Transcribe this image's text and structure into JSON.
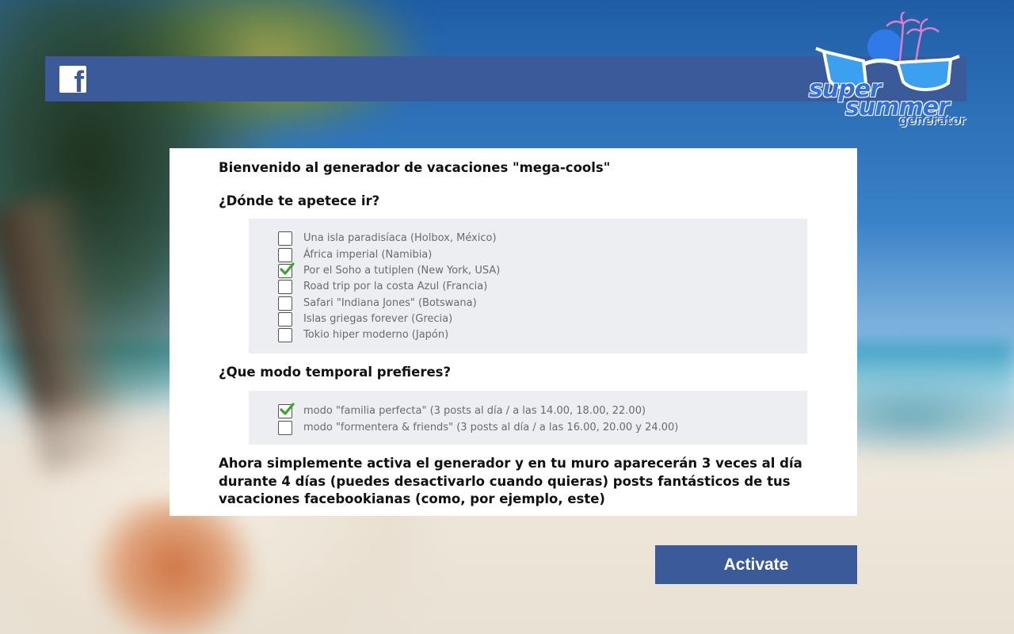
{
  "header": {
    "fb_icon": "facebook-icon",
    "fb_glyph": "f",
    "brand_line1": "super",
    "brand_line2": "summer",
    "brand_line3": "generator"
  },
  "card": {
    "welcome": "Bienvenido al generador de vacaciones \"mega-cools\"",
    "question_destination": "¿Dónde te apetece ir?",
    "destinations": [
      {
        "label": "Una isla paradisíaca (Holbox, México)",
        "checked": false
      },
      {
        "label": "África imperial (Namibia)",
        "checked": false
      },
      {
        "label": "Por el Soho a tutiplen (New York, USA)",
        "checked": true
      },
      {
        "label": "Road trip por la costa Azul (Francia)",
        "checked": false
      },
      {
        "label": "Safari \"Indiana Jones\" (Botswana)",
        "checked": false
      },
      {
        "label": "Islas griegas forever (Grecia)",
        "checked": false
      },
      {
        "label": "Tokio hiper moderno (Japón)",
        "checked": false
      }
    ],
    "question_mode": "¿Que modo temporal prefieres?",
    "modes": [
      {
        "label": "modo \"familia perfecta\" (3 posts al día / a las 14.00, 18.00, 22.00)",
        "checked": true
      },
      {
        "label": "modo \"formentera & friends\" (3 posts al día / a las 16.00, 20.00 y 24.00)",
        "checked": false
      }
    ],
    "closing": "Ahora simplemente activa el generador y en tu muro aparecerán 3 veces al día durante 4 días (puedes desactivarlo cuando quieras) posts fantásticos de tus vacaciones facebookianas (como, por ejemplo, este)"
  },
  "actions": {
    "activate_label": "Activate"
  },
  "colors": {
    "facebook_blue": "#3b5a9a",
    "check_green": "#3aa52a",
    "panel_gray": "#eceef2"
  }
}
